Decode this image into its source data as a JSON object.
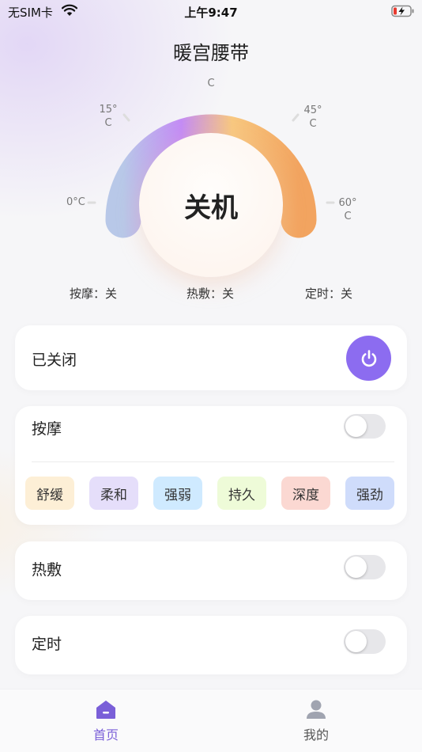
{
  "status_bar": {
    "carrier": "无SIM卡",
    "time": "上午9:47"
  },
  "title": "暖宫腰带",
  "dial": {
    "ticks": {
      "t0": "0°C",
      "t15_a": "15°",
      "t15_b": "C",
      "t30": "C",
      "t45_a": "45°",
      "t45_b": "C",
      "t60_a": "60°",
      "t60_b": "C"
    },
    "center_text": "关机",
    "gradient": [
      "#b8c8e8",
      "#c48cf5",
      "#f8c880",
      "#f2a460"
    ]
  },
  "status_row": {
    "massage": "按摩：关",
    "heat": "热敷：关",
    "timer": "定时：关"
  },
  "power_card": {
    "label": "已关闭",
    "accent": "#8c6cf0"
  },
  "massage_card": {
    "label": "按摩",
    "toggle_on": false,
    "modes": [
      {
        "label": "舒缓",
        "color": "#fdefd6"
      },
      {
        "label": "柔和",
        "color": "#e5defa"
      },
      {
        "label": "强弱",
        "color": "#cfeaff"
      },
      {
        "label": "持久",
        "color": "#eefbd8"
      },
      {
        "label": "深度",
        "color": "#fbd8d2"
      },
      {
        "label": "强劲",
        "color": "#cfdcfb"
      }
    ]
  },
  "heat_card": {
    "label": "热敷",
    "toggle_on": false
  },
  "timer_card": {
    "label": "定时",
    "toggle_on": false
  },
  "tab_bar": {
    "home": {
      "label": "首页",
      "color": "#7a5fd8"
    },
    "mine": {
      "label": "我的",
      "color": "#555555"
    }
  }
}
